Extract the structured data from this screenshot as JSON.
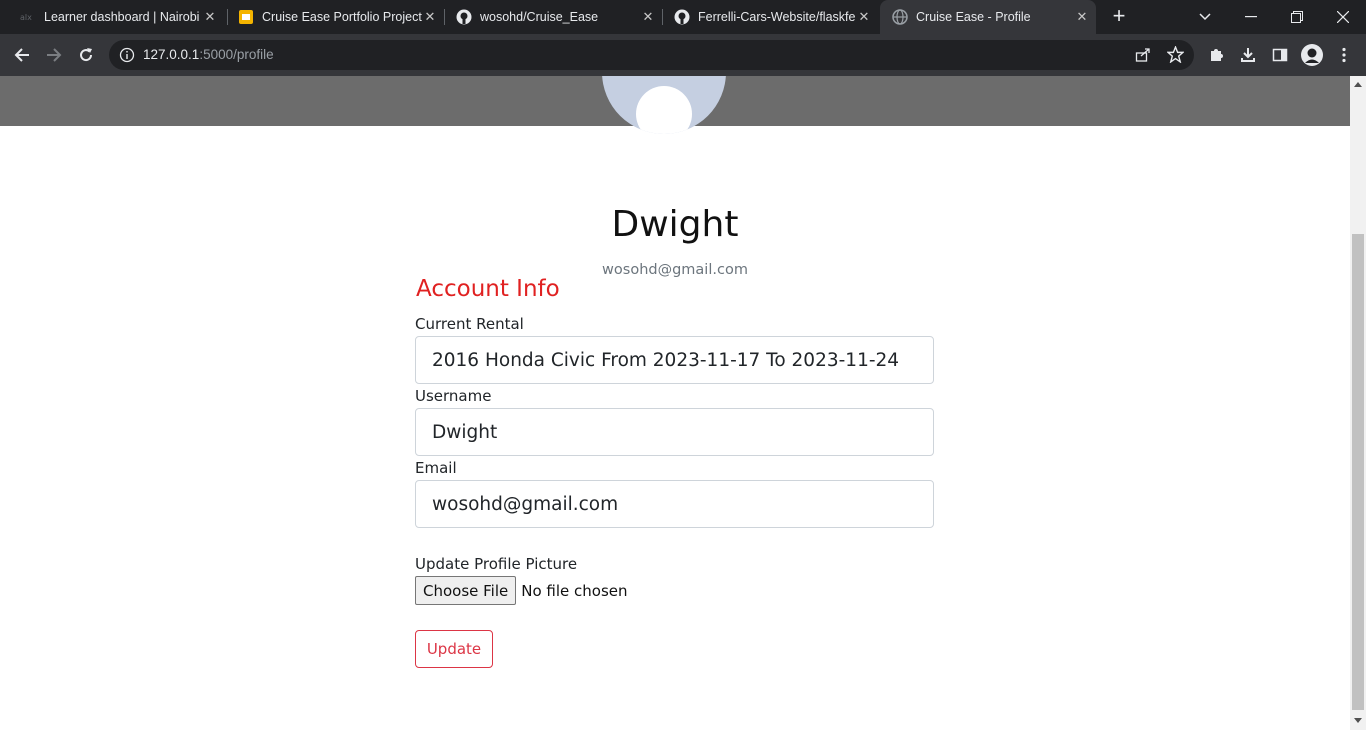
{
  "browser": {
    "tabs": [
      {
        "title": "Learner dashboard | Nairobi",
        "icon": "alx-favicon",
        "active": false
      },
      {
        "title": "Cruise Ease Portfolio Project",
        "icon": "slides-favicon",
        "active": false
      },
      {
        "title": "wosohd/Cruise_Ease",
        "icon": "github-favicon",
        "active": false
      },
      {
        "title": "Ferrelli-Cars-Website/flaskfe",
        "icon": "github-favicon",
        "active": false
      },
      {
        "title": "Cruise Ease - Profile",
        "icon": "globe-favicon",
        "active": true
      }
    ],
    "url_host": "127.0.0.1",
    "url_rest": ":5000/profile"
  },
  "profile": {
    "name": "Dwight",
    "email": "wosohd@gmail.com"
  },
  "form": {
    "section_title": "Account Info",
    "current_rental_label": "Current Rental",
    "current_rental_value": "2016 Honda Civic From 2023-11-17 To 2023-11-24",
    "username_label": "Username",
    "username_value": "Dwight",
    "email_label": "Email",
    "email_value": "wosohd@gmail.com",
    "picture_label": "Update Profile Picture",
    "choose_file_label": "Choose File",
    "no_file_text": "No file chosen",
    "update_label": "Update"
  },
  "colors": {
    "accent_red": "#dc3545",
    "section_title_red": "#e02121",
    "banner_gray": "#6c6c6c",
    "avatar_bg": "#c5cfe1"
  }
}
